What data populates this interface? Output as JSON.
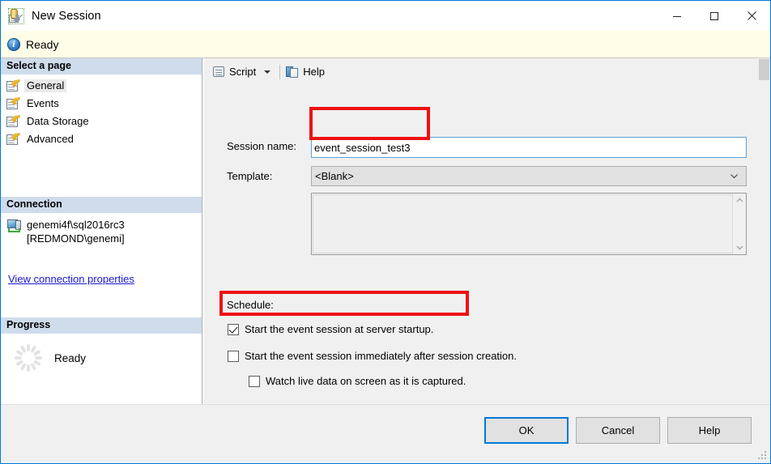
{
  "window": {
    "title": "New Session",
    "icon": "session-icon",
    "controls": {
      "minimize": "minimize-icon",
      "maximize": "maximize-icon",
      "close": "close-icon"
    }
  },
  "status_bar": {
    "icon": "info-icon",
    "text": "Ready"
  },
  "sidebar": {
    "select_page_header": "Select a page",
    "pages": [
      {
        "label": "General",
        "selected": true
      },
      {
        "label": "Events",
        "selected": false
      },
      {
        "label": "Data Storage",
        "selected": false
      },
      {
        "label": "Advanced",
        "selected": false
      }
    ],
    "connection_header": "Connection",
    "connection_server": "genemi4f\\sql2016rc3",
    "connection_user": "[REDMOND\\genemi]",
    "connection_link": "View connection properties",
    "progress_header": "Progress",
    "progress_text": "Ready"
  },
  "toolbar": {
    "script_label": "Script",
    "help_label": "Help"
  },
  "form": {
    "session_name_label": "Session name:",
    "session_name_value": "event_session_test3",
    "template_label": "Template:",
    "template_value": "<Blank>",
    "description_value": "",
    "schedule_label": "Schedule:",
    "checkboxes": [
      {
        "label": "Start the event session at server startup.",
        "checked": true,
        "indent": false
      },
      {
        "label": "Start the event session immediately after session creation.",
        "checked": false,
        "indent": false
      },
      {
        "label": "Watch live data on screen as it is captured.",
        "checked": false,
        "indent": true
      }
    ]
  },
  "annotations": {
    "color": "#ee1111",
    "boxes": [
      {
        "name": "session-name-highlight"
      },
      {
        "name": "startup-checkbox-highlight"
      }
    ]
  },
  "footer": {
    "ok_label": "OK",
    "cancel_label": "Cancel",
    "help_label": "Help"
  }
}
